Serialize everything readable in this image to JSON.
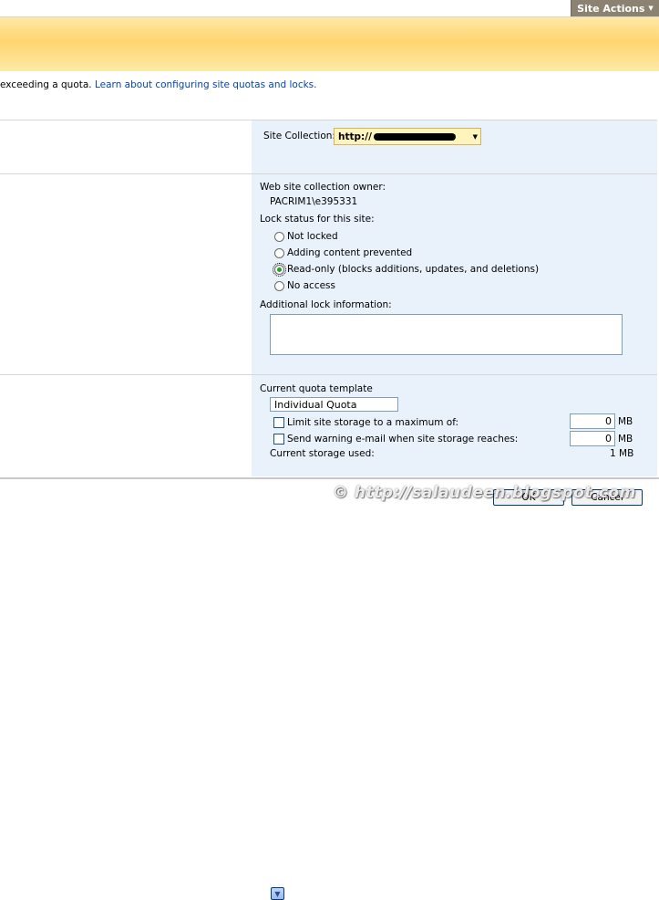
{
  "topbar": {
    "site_actions_label": "Site Actions",
    "caret": "▼"
  },
  "intro": {
    "text": "exceeding a quota.",
    "link": "Learn about configuring site quotas and locks."
  },
  "site_collection": {
    "label": "Site Collection:",
    "url_value": "http://"
  },
  "owner": {
    "label": "Web site collection owner:",
    "value": "PACRIM1\\e395331"
  },
  "lock": {
    "label": "Lock status for this site:",
    "options": [
      {
        "label": "Not locked",
        "checked": false
      },
      {
        "label": "Adding content prevented",
        "checked": false
      },
      {
        "label": "Read-only (blocks additions, updates, and deletions)",
        "checked": true
      },
      {
        "label": "No access",
        "checked": false
      }
    ],
    "additional_label": "Additional lock information:",
    "additional_value": ""
  },
  "quota": {
    "template_label": "Current quota template",
    "template_value": "Individual Quota",
    "limit_label": "Limit site storage to a maximum of:",
    "limit_value": "0",
    "warning_label": "Send warning e-mail when site storage reaches:",
    "warning_value": "0",
    "unit": "MB",
    "used_label": "Current storage used:",
    "used_value": "1 MB"
  },
  "buttons": {
    "ok": "OK",
    "cancel": "Cancel"
  },
  "watermark": "© http://salaudeen.blogspot.com",
  "colors": {
    "accent_banner": "#ffd56f",
    "panel": "#e9f1fb",
    "link": "#0645ad",
    "radio_selected": "#21a121"
  }
}
